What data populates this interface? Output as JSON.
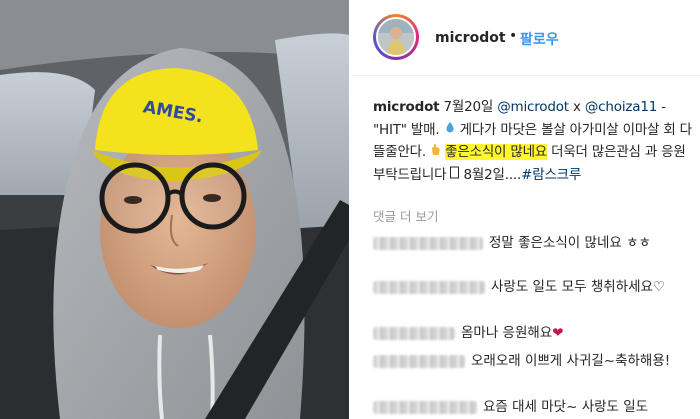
{
  "post": {
    "username": "microdot",
    "header_dot": "•",
    "follow_label": "팔로우",
    "caption": {
      "username": "microdot",
      "part1": " 7월20일 ",
      "mention1": "@microdot",
      "part2": " x ",
      "mention2": "@choiza11",
      "part3": " - \"HIT\" 발매. ",
      "part4": " 게다가 마닷은 볼살 아가미살 이마살 회 다뜰줄안다.",
      "highlight": "좋은소식이 많네요",
      "part5": " 더욱더 많은관심 과 응원 부탁드립니다",
      "part6": " 8월2일....",
      "hashtag": "#람스크루"
    },
    "view_more_label": "댓글 더 보기",
    "comments": [
      {
        "text": "정말 좋은소식이 많네요 ㅎㅎ"
      },
      {
        "text": "사랑도 일도 모두 챙취하세요♡"
      },
      {
        "text": "옴마나 응원해요",
        "emoji": "❤"
      },
      {
        "text": "오래오래 이쁘게 사귀길~축하해용!"
      },
      {
        "text": "요즘 대세 마닷~ 사랑도 일도"
      }
    ]
  },
  "photo": {
    "cap_text": "AMES.",
    "cap_color": "#f4e21c"
  }
}
